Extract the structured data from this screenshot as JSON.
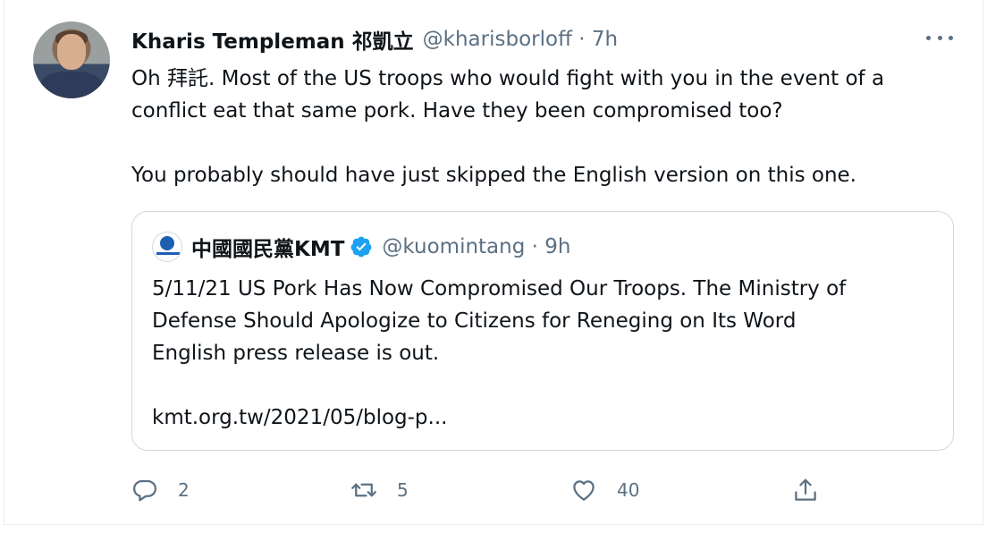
{
  "tweet": {
    "author_name": "Kharis Templeman 祁凱立",
    "author_handle_time": "@kharisborloff · 7h",
    "text": "Oh 拜託. Most of the US troops who would fight with you in the event of a\nconflict eat that same pork. Have they been compromised too?\n\nYou probably should have just skipped the English version on this one."
  },
  "quoted": {
    "author_name": "中國國民黨KMT",
    "author_handle_time": "@kuomintang · 9h",
    "text": "5/11/21 US Pork Has Now Compromised Our Troops. The Ministry of\nDefense Should Apologize to Citizens for Reneging on Its Word\nEnglish press release is out.\n\nkmt.org.tw/2021/05/blog-p..."
  },
  "actions": {
    "reply_count": "2",
    "retweet_count": "5",
    "like_count": "40"
  },
  "colors": {
    "secondary_text": "#5b7083",
    "verified": "#1da1f2",
    "border": "#cfd9de"
  },
  "icons": [
    "more-icon",
    "verified-icon",
    "reply-icon",
    "retweet-icon",
    "like-icon",
    "share-icon"
  ]
}
